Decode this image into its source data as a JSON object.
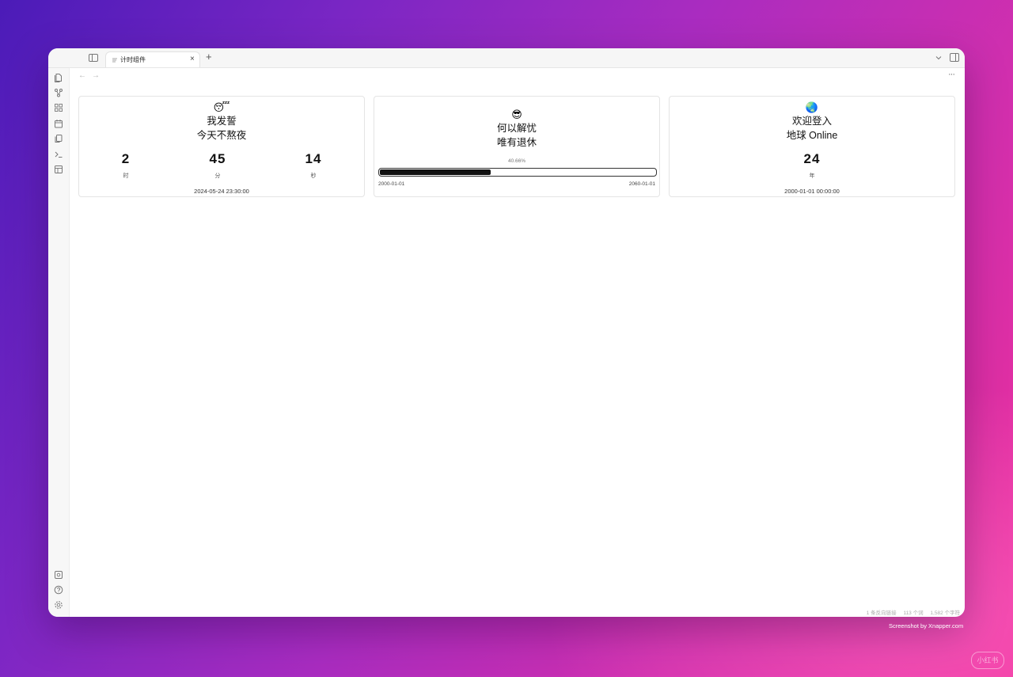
{
  "window": {
    "tab": {
      "title": "计时组件",
      "close": "×"
    },
    "new_tab": "+",
    "nav": {
      "back": "←",
      "forward": "→"
    },
    "more": "···"
  },
  "ribbon": {
    "icons": [
      "file-icon",
      "graph-icon",
      "grid-icon",
      "calendar-icon",
      "copy-icon",
      "terminal-icon",
      "layout-icon",
      "vault-icon",
      "help-icon",
      "settings-icon"
    ]
  },
  "cards": {
    "countdown": {
      "emoji": "😴",
      "title_line1": "我发誓",
      "title_line2": "今天不熬夜",
      "hours": "2",
      "hours_label": "时",
      "minutes": "45",
      "minutes_label": "分",
      "seconds": "14",
      "seconds_label": "秒",
      "target": "2024-05-24 23:30:00"
    },
    "progress": {
      "emoji": "😎",
      "title_line1": "何以解忧",
      "title_line2": "唯有退休",
      "percent_text": "40.66%",
      "percent_value": 40.66,
      "start": "2000-01-01",
      "end": "2060-01-01"
    },
    "elapsed": {
      "emoji": "🌏",
      "title_line1": "欢迎登入",
      "title_line2": "地球 Online",
      "years": "24",
      "years_label": "年",
      "since": "2000-01-01 00:00:00"
    }
  },
  "status_bar": {
    "backlinks": "1 条反向链接",
    "words": "113 个词",
    "chars": "1,582 个字符"
  },
  "screenshot_credit": "Screenshot by Xnapper.com",
  "watermark": "小红书"
}
